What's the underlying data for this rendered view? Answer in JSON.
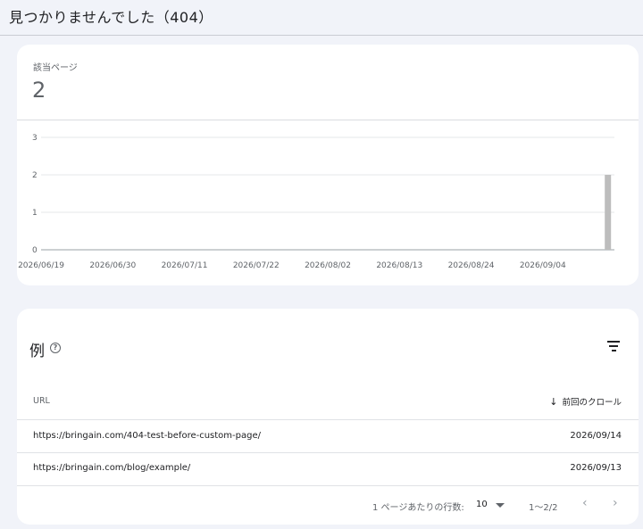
{
  "header": {
    "title": "見つかりませんでした（404）"
  },
  "summary": {
    "label": "該当ページ",
    "value": "2"
  },
  "chart_data": {
    "type": "bar",
    "x_ticks": [
      "2026/06/19",
      "2026/06/30",
      "2026/07/11",
      "2026/07/22",
      "2026/08/02",
      "2026/08/13",
      "2026/08/24",
      "2026/09/04"
    ],
    "y_ticks": [
      "0",
      "1",
      "2",
      "3"
    ],
    "ylim": [
      0,
      3
    ],
    "xlim": [
      "2026/06/19",
      "2026/09/15"
    ],
    "grid": true,
    "x": [
      "2026/09/14"
    ],
    "values": [
      2
    ],
    "bar_color": "#bdbdbd"
  },
  "examples": {
    "title": "例",
    "columns": {
      "url": "URL",
      "crawl": "前回のクロール"
    },
    "rows": [
      {
        "url": "https://bringain.com/404-test-before-custom-page/",
        "date": "2026/09/14"
      },
      {
        "url": "https://bringain.com/blog/example/",
        "date": "2026/09/13"
      }
    ],
    "pagination": {
      "rows_label": "1 ページあたりの行数:",
      "rows_value": "10",
      "range": "1〜2/2"
    }
  }
}
